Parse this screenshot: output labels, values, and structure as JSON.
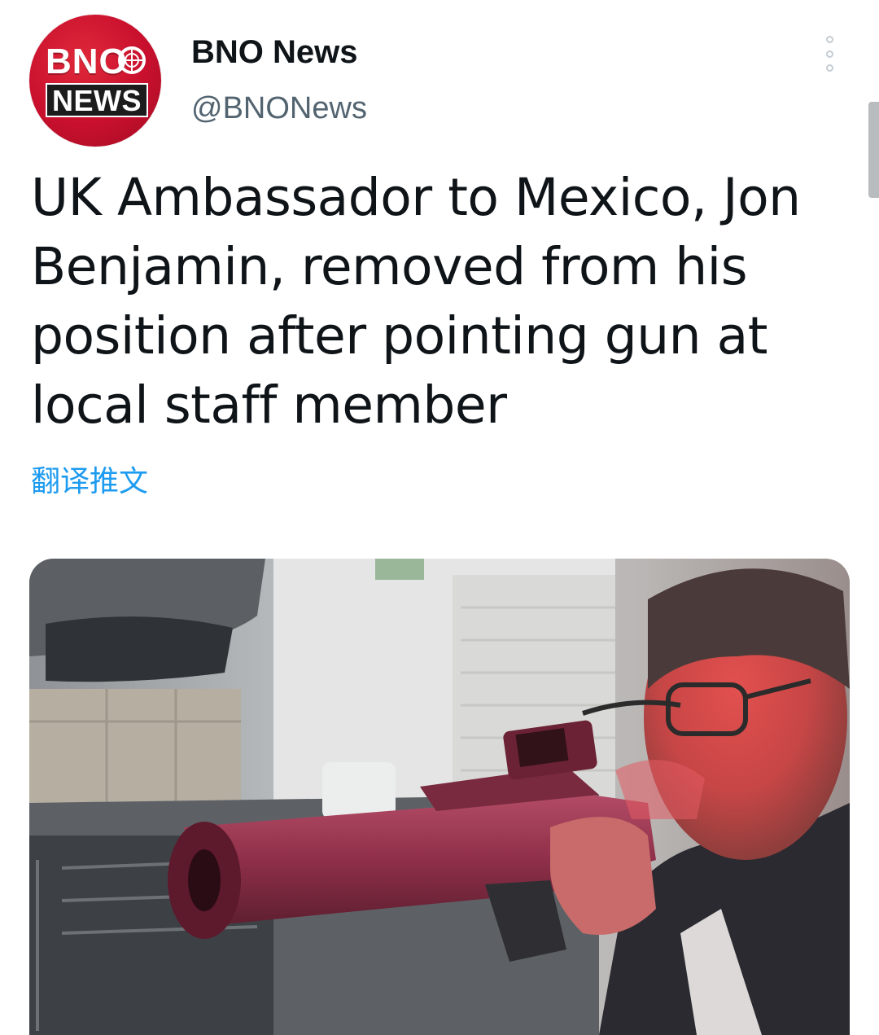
{
  "header": {
    "avatar": {
      "logo_line1": "BNO",
      "logo_line2": "NEWS",
      "colors": {
        "brand_red": "#c8102e",
        "news_box": "#1c1c1c"
      }
    },
    "display_name": "BNO News",
    "handle": "@BNONews",
    "more_icon": "more-vertical-dots-icon"
  },
  "tweet": {
    "lines": [
      "UK Ambassador to Mexico, Jon",
      "Benjamin, removed from his",
      "position after pointing gun at",
      "local staff member"
    ],
    "translate_label": "翻译推文"
  },
  "media": {
    "type": "video-still",
    "depicts": "man-aiming-gun-in-office"
  },
  "colors": {
    "text_primary": "#0f1419",
    "text_secondary": "#536471",
    "link_blue": "#1d9bf0"
  }
}
